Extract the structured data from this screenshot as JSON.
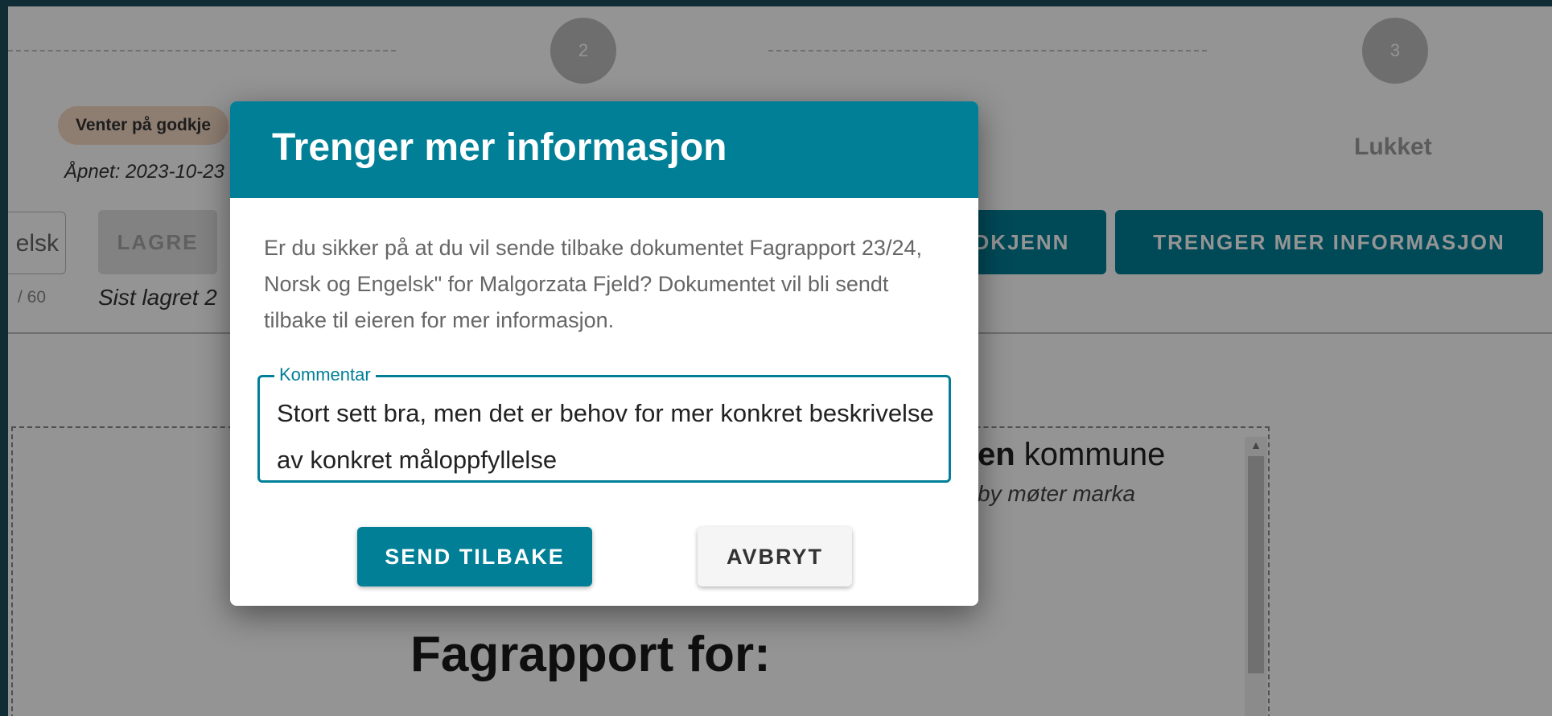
{
  "stepper": {
    "steps": [
      {
        "number": "2"
      },
      {
        "number": "3",
        "label": "Lukket"
      }
    ]
  },
  "document": {
    "status_badge": "Venter på godkje",
    "opened_text": "Åpnet: 2023-10-23",
    "language_select_value": "elsk",
    "char_counter": "/ 60",
    "save_label": "LAGRE",
    "saved_text": "Sist lagret 2",
    "approve_label": "DKJENN",
    "more_info_label": "TRENGER MER INFORMASJON",
    "municipality_bold": "en",
    "municipality_rest": " kommune",
    "tagline": "by møter marka",
    "report_title": "Fagrapport for:"
  },
  "dialog": {
    "title": "Trenger mer informasjon",
    "body": "Er du sikker på at du vil sende tilbake dokumentet Fagrapport 23/24, Norsk og Engelsk\" for Malgorzata Fjeld? Dokumentet vil bli sendt tilbake til eieren for mer informasjon.",
    "comment_label": "Kommentar",
    "comment_value": "Stort sett bra, men det er behov for mer konkret beskrivelse av konkret måloppfyllelse",
    "send_label": "SEND TILBAKE",
    "cancel_label": "AVBRYT"
  },
  "colors": {
    "primary": "#007f96",
    "badge_bg": "#f5d9c4",
    "window_frame": "#1c4f5c"
  }
}
